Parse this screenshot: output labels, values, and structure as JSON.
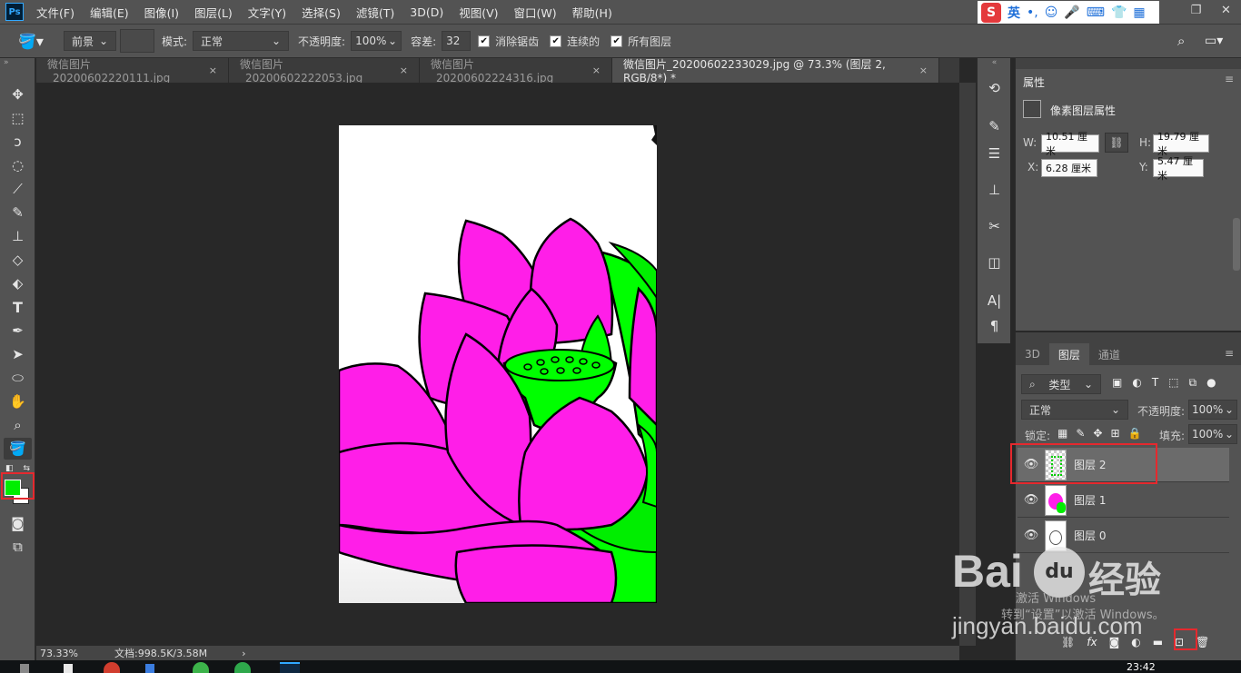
{
  "app": {
    "logo": "Ps",
    "menu": [
      "文件(F)",
      "编辑(E)",
      "图像(I)",
      "图层(L)",
      "文字(Y)",
      "选择(S)",
      "滤镜(T)",
      "3D(D)",
      "视图(V)",
      "窗口(W)",
      "帮助(H)"
    ]
  },
  "ime": {
    "brand": "S",
    "lang": "英",
    "punct": "•,"
  },
  "options": {
    "fill_source": "前景",
    "mode_label": "模式:",
    "mode_value": "正常",
    "opacity_label": "不透明度:",
    "opacity_value": "100%",
    "tolerance_label": "容差:",
    "tolerance_value": "32",
    "antialias_label": "消除锯齿",
    "contiguous_label": "连续的",
    "all_layers_label": "所有图层"
  },
  "tabs": [
    {
      "label": "微信图片_20200602220111.jpg",
      "active": false
    },
    {
      "label": "微信图片_20200602222053.jpg",
      "active": false
    },
    {
      "label": "微信图片_20200602224316.jpg",
      "active": false
    },
    {
      "label": "微信图片_20200602233029.jpg @ 73.3% (图层 2, RGB/8*) *",
      "active": true
    }
  ],
  "tab_close": "×",
  "status": {
    "zoom": "73.33%",
    "doc": "文档:998.5K/3.58M",
    "arrow": "›"
  },
  "properties": {
    "title": "属性",
    "subtitle": "像素图层属性",
    "w_label": "W:",
    "w_value": "10.51 厘米",
    "h_label": "H:",
    "h_value": "19.79 厘米",
    "x_label": "X:",
    "x_value": "6.28 厘米",
    "y_label": "Y:",
    "y_value": "5.47 厘米"
  },
  "layers_panel": {
    "tabs": [
      "3D",
      "图层",
      "通道"
    ],
    "filter_label": "类型",
    "blend_mode": "正常",
    "opacity_label": "不透明度:",
    "opacity_value": "100%",
    "lock_label": "锁定:",
    "fill_label": "填充:",
    "fill_value": "100%",
    "layers": [
      {
        "name": "图层 2",
        "selected": true
      },
      {
        "name": "图层 1",
        "selected": false
      },
      {
        "name": "图层 0",
        "selected": false
      }
    ],
    "bottom_icons": [
      "link-icon",
      "fx-icon",
      "mask-icon",
      "adjustment-icon",
      "group-icon",
      "new-layer-icon",
      "trash-icon"
    ]
  },
  "watermark": {
    "brand": "Bai",
    "paw": "du",
    "cn": "经验",
    "site": "jingyan.baidu.com",
    "win1": "激活 Windows",
    "win2": "转到“设置”以激活 Windows。"
  },
  "taskbar_time": "23:42",
  "colors": {
    "foreground": "#00ee00",
    "petal": "#ff1ee8",
    "leaf": "#00ff00",
    "highlight": "#e5292e"
  }
}
